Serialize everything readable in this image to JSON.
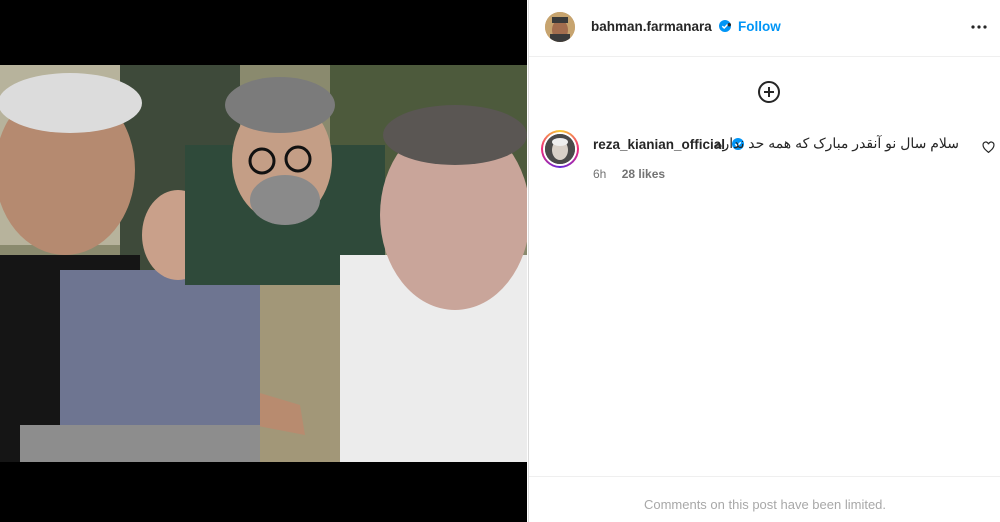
{
  "post": {
    "author": {
      "username": "bahman.farmanara",
      "verified": true,
      "follow_label": "Follow",
      "separator": "•"
    },
    "more_icon": "more-horizontal-icon",
    "add_icon": "plus-circle-icon"
  },
  "caption": {
    "username": "reza_kianian_official",
    "verified": true,
    "text": "سلام سال نو آنقدر مبارک که همه حد نداره",
    "time": "6h",
    "likes": "28 likes"
  },
  "footer": {
    "limited_text": "Comments on this post have been limited."
  },
  "colors": {
    "accent": "#0095f6",
    "verified": "#0095f6",
    "muted": "#737373"
  }
}
